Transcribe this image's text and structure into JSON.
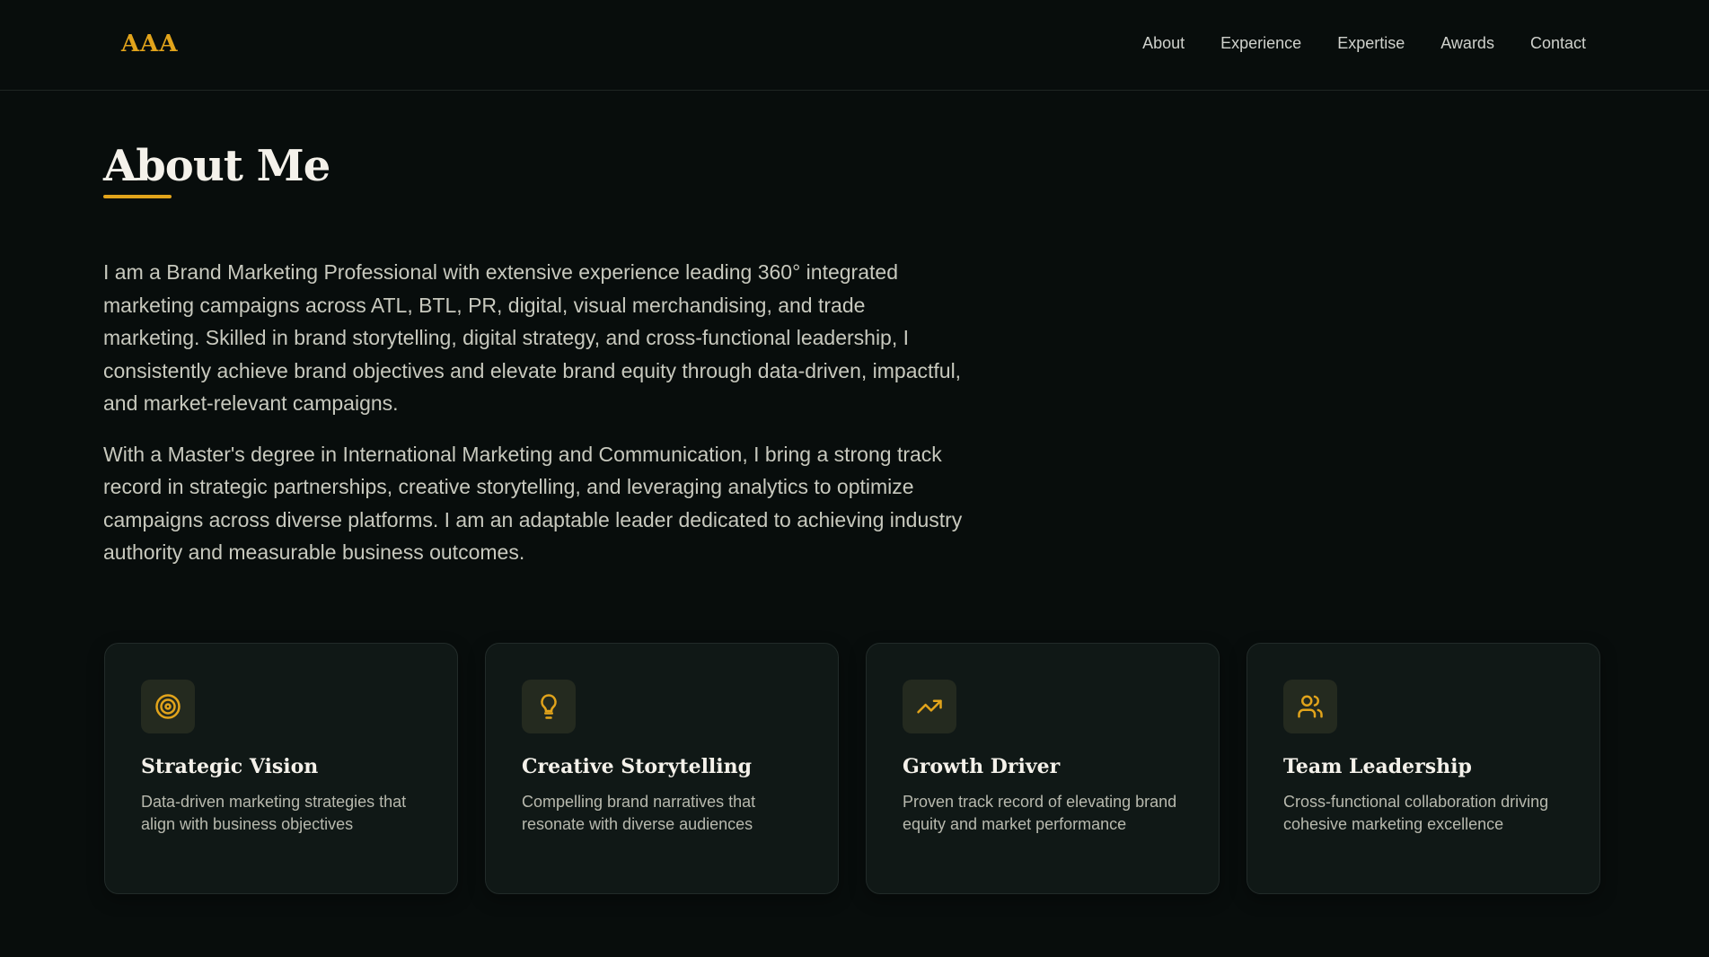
{
  "brand": {
    "logo_text": "AAA",
    "accent_color": "#e2a41b"
  },
  "nav": {
    "items": [
      {
        "label": "About"
      },
      {
        "label": "Experience"
      },
      {
        "label": "Expertise"
      },
      {
        "label": "Awards"
      },
      {
        "label": "Contact"
      }
    ]
  },
  "about": {
    "title": "About Me",
    "paragraphs": [
      "I am a Brand Marketing Professional with extensive experience leading 360° integrated marketing campaigns across ATL, BTL, PR, digital, visual merchandising, and trade marketing. Skilled in brand storytelling, digital strategy, and cross-functional leadership, I consistently achieve brand objectives and elevate brand equity through data-driven, impactful, and market-relevant campaigns.",
      "With a Master's degree in International Marketing and Communication, I bring a strong track record in strategic partnerships, creative storytelling, and leveraging analytics to optimize campaigns across diverse platforms. I am an adaptable leader dedicated to achieving industry authority and measurable business outcomes."
    ]
  },
  "cards": [
    {
      "icon": "target-icon",
      "title": "Strategic Vision",
      "description": "Data-driven marketing strategies that align with business objectives"
    },
    {
      "icon": "lightbulb-icon",
      "title": "Creative Storytelling",
      "description": "Compelling brand narratives that resonate with diverse audiences"
    },
    {
      "icon": "trending-up-icon",
      "title": "Growth Driver",
      "description": "Proven track record of elevating brand equity and market performance"
    },
    {
      "icon": "users-icon",
      "title": "Team Leadership",
      "description": "Cross-functional collaboration driving cohesive marketing excellence"
    }
  ]
}
